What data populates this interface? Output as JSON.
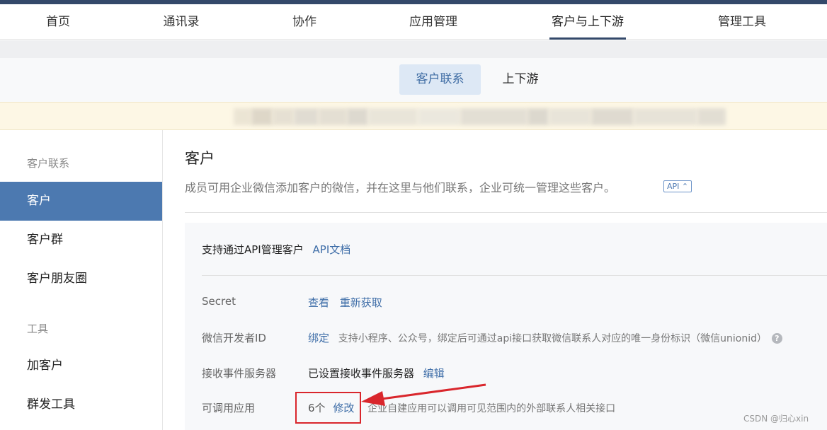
{
  "top_nav": {
    "items": [
      {
        "label": "首页"
      },
      {
        "label": "通讯录"
      },
      {
        "label": "协作"
      },
      {
        "label": "应用管理"
      },
      {
        "label": "客户与上下游"
      },
      {
        "label": "管理工具"
      }
    ],
    "active_index": 4
  },
  "sub_tabs": {
    "items": [
      {
        "label": "客户联系"
      },
      {
        "label": "上下游"
      }
    ],
    "active_index": 0
  },
  "sidebar": {
    "group1_title": "客户联系",
    "items1": [
      {
        "label": "客户"
      },
      {
        "label": "客户群"
      },
      {
        "label": "客户朋友圈"
      }
    ],
    "group2_title": "工具",
    "items2": [
      {
        "label": "加客户"
      },
      {
        "label": "群发工具"
      }
    ],
    "active_item": "客户"
  },
  "main": {
    "title": "客户",
    "description": "成员可用企业微信添加客户的微信，并在这里与他们联系，企业可统一管理这些客户。",
    "api_badge": "API ⌃",
    "panel": {
      "head_text": "支持通过API管理客户",
      "head_link": "API文档",
      "rows": [
        {
          "label": "Secret",
          "link1": "查看",
          "link2": "重新获取"
        },
        {
          "label": "微信开发者ID",
          "link": "绑定",
          "hint": "支持小程序、公众号，绑定后可通过api接口获取微信联系人对应的唯一身份标识（微信unionid）"
        },
        {
          "label": "接收事件服务器",
          "value": "已设置接收事件服务器",
          "link": "编辑"
        },
        {
          "label": "可调用应用",
          "value": "6个",
          "link": "修改",
          "hint": "企业自建应用可以调用可见范围内的外部联系人相关接口"
        }
      ]
    }
  },
  "watermark": "CSDN @归心xin",
  "colors": {
    "brand_navy": "#34496a",
    "sidebar_active": "#4c79b0",
    "link": "#3f6ea8",
    "annotation_red": "#d9262c"
  }
}
